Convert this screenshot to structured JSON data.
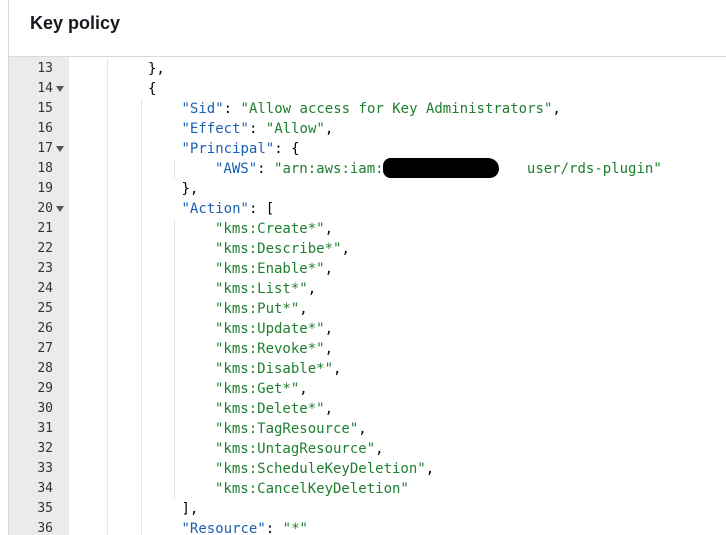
{
  "header": {
    "title": "Key policy"
  },
  "code_lines": [
    {
      "n": "13",
      "fold": false,
      "indent": 2,
      "parts": [
        {
          "t": "},",
          "c": "p"
        }
      ]
    },
    {
      "n": "14",
      "fold": true,
      "indent": 2,
      "parts": [
        {
          "t": "{",
          "c": "p"
        }
      ]
    },
    {
      "n": "15",
      "fold": false,
      "indent": 3,
      "parts": [
        {
          "t": "\"Sid\"",
          "c": "key"
        },
        {
          "t": ": ",
          "c": "p"
        },
        {
          "t": "\"Allow access for Key Administrators\"",
          "c": "str"
        },
        {
          "t": ",",
          "c": "p"
        }
      ]
    },
    {
      "n": "16",
      "fold": false,
      "indent": 3,
      "parts": [
        {
          "t": "\"Effect\"",
          "c": "key"
        },
        {
          "t": ": ",
          "c": "p"
        },
        {
          "t": "\"Allow\"",
          "c": "str"
        },
        {
          "t": ",",
          "c": "p"
        }
      ]
    },
    {
      "n": "17",
      "fold": true,
      "indent": 3,
      "parts": [
        {
          "t": "\"Principal\"",
          "c": "key"
        },
        {
          "t": ": {",
          "c": "p"
        }
      ]
    },
    {
      "n": "18",
      "fold": false,
      "indent": 4,
      "parts": [
        {
          "t": "\"AWS\"",
          "c": "key"
        },
        {
          "t": ": ",
          "c": "p"
        },
        {
          "t": "\"arn:aws:iam::",
          "c": "str"
        },
        {
          "t": "                ",
          "c": "p"
        },
        {
          "t": "user/rds-plugin\"",
          "c": "str"
        }
      ]
    },
    {
      "n": "19",
      "fold": false,
      "indent": 3,
      "parts": [
        {
          "t": "},",
          "c": "p"
        }
      ]
    },
    {
      "n": "20",
      "fold": true,
      "indent": 3,
      "parts": [
        {
          "t": "\"Action\"",
          "c": "key"
        },
        {
          "t": ": [",
          "c": "p"
        }
      ]
    },
    {
      "n": "21",
      "fold": false,
      "indent": 4,
      "parts": [
        {
          "t": "\"kms:Create*\"",
          "c": "str"
        },
        {
          "t": ",",
          "c": "p"
        }
      ]
    },
    {
      "n": "22",
      "fold": false,
      "indent": 4,
      "parts": [
        {
          "t": "\"kms:Describe*\"",
          "c": "str"
        },
        {
          "t": ",",
          "c": "p"
        }
      ]
    },
    {
      "n": "23",
      "fold": false,
      "indent": 4,
      "parts": [
        {
          "t": "\"kms:Enable*\"",
          "c": "str"
        },
        {
          "t": ",",
          "c": "p"
        }
      ]
    },
    {
      "n": "24",
      "fold": false,
      "indent": 4,
      "parts": [
        {
          "t": "\"kms:List*\"",
          "c": "str"
        },
        {
          "t": ",",
          "c": "p"
        }
      ]
    },
    {
      "n": "25",
      "fold": false,
      "indent": 4,
      "parts": [
        {
          "t": "\"kms:Put*\"",
          "c": "str"
        },
        {
          "t": ",",
          "c": "p"
        }
      ]
    },
    {
      "n": "26",
      "fold": false,
      "indent": 4,
      "parts": [
        {
          "t": "\"kms:Update*\"",
          "c": "str"
        },
        {
          "t": ",",
          "c": "p"
        }
      ]
    },
    {
      "n": "27",
      "fold": false,
      "indent": 4,
      "parts": [
        {
          "t": "\"kms:Revoke*\"",
          "c": "str"
        },
        {
          "t": ",",
          "c": "p"
        }
      ]
    },
    {
      "n": "28",
      "fold": false,
      "indent": 4,
      "parts": [
        {
          "t": "\"kms:Disable*\"",
          "c": "str"
        },
        {
          "t": ",",
          "c": "p"
        }
      ]
    },
    {
      "n": "29",
      "fold": false,
      "indent": 4,
      "parts": [
        {
          "t": "\"kms:Get*\"",
          "c": "str"
        },
        {
          "t": ",",
          "c": "p"
        }
      ]
    },
    {
      "n": "30",
      "fold": false,
      "indent": 4,
      "parts": [
        {
          "t": "\"kms:Delete*\"",
          "c": "str"
        },
        {
          "t": ",",
          "c": "p"
        }
      ]
    },
    {
      "n": "31",
      "fold": false,
      "indent": 4,
      "parts": [
        {
          "t": "\"kms:TagResource\"",
          "c": "str"
        },
        {
          "t": ",",
          "c": "p"
        }
      ]
    },
    {
      "n": "32",
      "fold": false,
      "indent": 4,
      "parts": [
        {
          "t": "\"kms:UntagResource\"",
          "c": "str"
        },
        {
          "t": ",",
          "c": "p"
        }
      ]
    },
    {
      "n": "33",
      "fold": false,
      "indent": 4,
      "parts": [
        {
          "t": "\"kms:ScheduleKeyDeletion\"",
          "c": "str"
        },
        {
          "t": ",",
          "c": "p"
        }
      ]
    },
    {
      "n": "34",
      "fold": false,
      "indent": 4,
      "parts": [
        {
          "t": "\"kms:CancelKeyDeletion\"",
          "c": "str"
        }
      ]
    },
    {
      "n": "35",
      "fold": false,
      "indent": 3,
      "parts": [
        {
          "t": "],",
          "c": "p"
        }
      ]
    },
    {
      "n": "36",
      "fold": false,
      "indent": 3,
      "parts": [
        {
          "t": "\"Resource\"",
          "c": "key"
        },
        {
          "t": ": ",
          "c": "p"
        },
        {
          "t": "\"*\"",
          "c": "str"
        }
      ]
    }
  ]
}
